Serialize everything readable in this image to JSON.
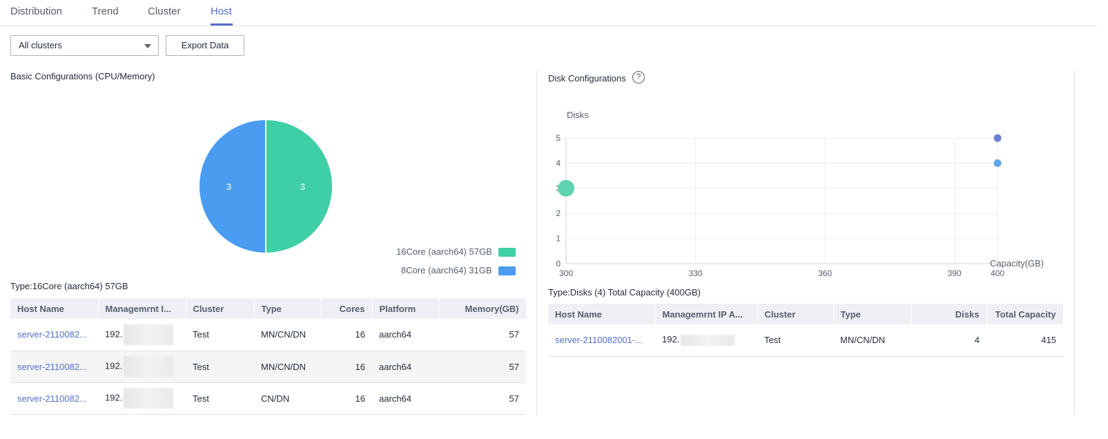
{
  "tabs": [
    {
      "label": "Distribution"
    },
    {
      "label": "Trend"
    },
    {
      "label": "Cluster"
    },
    {
      "label": "Host",
      "active": true
    }
  ],
  "toolbar": {
    "cluster_select_value": "All clusters",
    "export_label": "Export Data"
  },
  "left": {
    "title": "Basic Configurations (CPU/Memory)",
    "type_caption": "Type:16Core (aarch64) 57GB",
    "table": {
      "headers": [
        "Host Name",
        "Managemrnt I...",
        "Cluster",
        "Type",
        "Cores",
        "Platform",
        "Memory(GB)"
      ],
      "rows": [
        {
          "host": "server-2110082...",
          "ip": "192.",
          "cluster": "Test",
          "type": "MN/CN/DN",
          "cores": "16",
          "platform": "aarch64",
          "memory": "57"
        },
        {
          "host": "server-2110082...",
          "ip": "192.",
          "cluster": "Test",
          "type": "MN/CN/DN",
          "cores": "16",
          "platform": "aarch64",
          "memory": "57"
        },
        {
          "host": "server-2110082...",
          "ip": "192.",
          "cluster": "Test",
          "type": "CN/DN",
          "cores": "16",
          "platform": "aarch64",
          "memory": "57"
        }
      ]
    }
  },
  "right": {
    "title": "Disk Configurations",
    "help_icon": "question-circle-icon",
    "type_caption": "Type:Disks (4) Total Capacity (400GB)",
    "table": {
      "headers": [
        "Host Name",
        "Managemrnt IP A...",
        "Cluster",
        "Type",
        "Disks",
        "Total Capacity"
      ],
      "rows": [
        {
          "host": "server-2110082001-...",
          "ip": "192.",
          "cluster": "Test",
          "type": "MN/CN/DN",
          "disks": "4",
          "capacity": "415"
        }
      ]
    }
  },
  "chart_data": [
    {
      "type": "pie",
      "slices": [
        {
          "name": "16Core (aarch64) 57GB",
          "value": 3,
          "color": "#3ecfa6"
        },
        {
          "name": "8Core (aarch64) 31GB",
          "value": 3,
          "color": "#4a9cf1"
        }
      ],
      "legend_position": "bottom-right"
    },
    {
      "type": "scatter",
      "xlabel": "Capacity(GB)",
      "ylabel": "Disks",
      "xlim": [
        300,
        400
      ],
      "ylim": [
        0,
        5
      ],
      "xticks": [
        300,
        330,
        360,
        390,
        400
      ],
      "yticks": [
        0,
        1,
        2,
        3,
        4,
        5
      ],
      "grid": true,
      "points": [
        {
          "x": 300,
          "y": 3,
          "size": "large",
          "color": "#5fd3b0"
        },
        {
          "x": 400,
          "y": 4,
          "size": "small",
          "color": "#5aa6f0"
        },
        {
          "x": 400,
          "y": 5,
          "size": "small",
          "color": "#6a7fd6"
        }
      ]
    }
  ]
}
